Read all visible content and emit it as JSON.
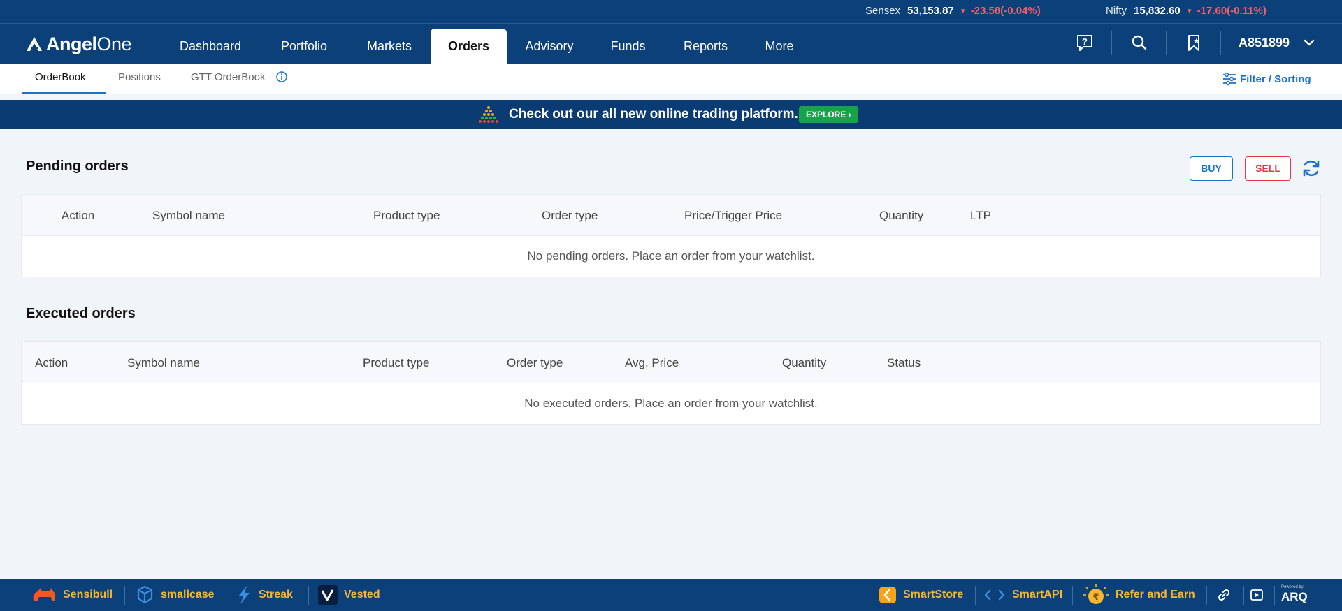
{
  "ticker": {
    "sensex": {
      "name": "Sensex",
      "value": "53,153.87",
      "change": "-23.58(-0.04%)"
    },
    "nifty": {
      "name": "Nifty",
      "value": "15,832.60",
      "change": "-17.60(-0.11%)"
    }
  },
  "brand": {
    "logo_bold": "Angel",
    "logo_thin": "One"
  },
  "nav": {
    "items": [
      "Dashboard",
      "Portfolio",
      "Markets",
      "Orders",
      "Advisory",
      "Funds",
      "Reports",
      "More"
    ],
    "active": "Orders",
    "account_id": "A851899"
  },
  "subtabs": {
    "items": [
      "OrderBook",
      "Positions",
      "GTT OrderBook"
    ],
    "active": "OrderBook",
    "filter_label": "Filter / Sorting"
  },
  "banner": {
    "text": "Check out our all new online trading platform.",
    "cta": "EXPLORE"
  },
  "pending": {
    "title": "Pending orders",
    "buy_label": "BUY",
    "sell_label": "SELL",
    "columns": [
      "Action",
      "Symbol name",
      "Product type",
      "Order type",
      "Price/Trigger Price",
      "Quantity",
      "LTP"
    ],
    "empty_text": "No pending orders. Place an order from your watchlist."
  },
  "executed": {
    "title": "Executed orders",
    "columns": [
      "Action",
      "Symbol name",
      "Product type",
      "Order type",
      "Avg. Price",
      "Quantity",
      "Status"
    ],
    "empty_text": "No executed orders. Place an order from your watchlist."
  },
  "footer": {
    "left": [
      "Sensibull",
      "smallcase",
      "Streak",
      "Vested"
    ],
    "right": [
      "SmartStore",
      "SmartAPI",
      "Refer and Earn"
    ],
    "arq_small": "Powered by",
    "arq": "ARQ"
  },
  "colors": {
    "navy": "#0b4079",
    "accent_blue": "#1a73c9",
    "sell_red": "#e53945",
    "footer_gold": "#f6b731",
    "explore_green": "#16a34a"
  },
  "icons": [
    "help-icon",
    "search-icon",
    "watchlist-icon",
    "chevron-down-icon",
    "info-icon",
    "filter-icon",
    "refresh-icon",
    "link-icon",
    "play-icon"
  ]
}
